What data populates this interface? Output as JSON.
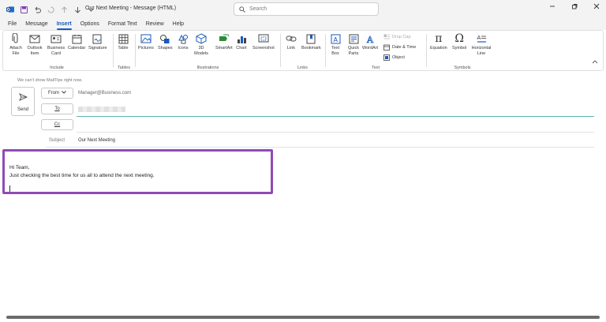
{
  "window": {
    "title": "Our Next Meeting  -  Message (HTML)",
    "search_placeholder": "Search"
  },
  "menu_tabs": [
    "File",
    "Message",
    "Insert",
    "Options",
    "Format Text",
    "Review",
    "Help"
  ],
  "active_tab": "Insert",
  "ribbon": {
    "include": {
      "label": "Include",
      "attach_file": "Attach File",
      "outlook_item": "Outlook Item",
      "business_card": "Business Card",
      "calendar": "Calendar",
      "signature": "Signature"
    },
    "tables": {
      "label": "Tables",
      "table": "Table"
    },
    "illustrations": {
      "label": "Illustrations",
      "pictures": "Pictures",
      "shapes": "Shapes",
      "icons": "Icons",
      "models_3d": "3D Models",
      "smartart": "SmartArt",
      "chart": "Chart",
      "screenshot": "Screenshot"
    },
    "links": {
      "label": "Links",
      "link": "Link",
      "bookmark": "Bookmark"
    },
    "text": {
      "label": "Text",
      "text_box": "Text Box",
      "quick_parts": "Quick Parts",
      "wordart": "WordArt",
      "drop_cap": "Drop Cap",
      "date_time": "Date & Time",
      "object": "Object"
    },
    "symbols": {
      "label": "Symbols",
      "equation": "Equation",
      "symbol": "Symbol",
      "horizontal_line": "Horizontal Line"
    }
  },
  "compose": {
    "info": "We can't show MailTips right now.",
    "send_label": "Send",
    "from_label": "From",
    "from_value": "Manager@Business.com",
    "to_label": "To",
    "cc_label": "Cc",
    "subject_label": "Subject",
    "subject_value": "Our Next Meeting",
    "body_line1": "Hi Team,",
    "body_line2": "Just checking the best time for us all to attend the next meeting."
  },
  "colors": {
    "accent": "#185abd",
    "highlight": "#8e4bb5",
    "to_underline": "#5fb3b3"
  }
}
